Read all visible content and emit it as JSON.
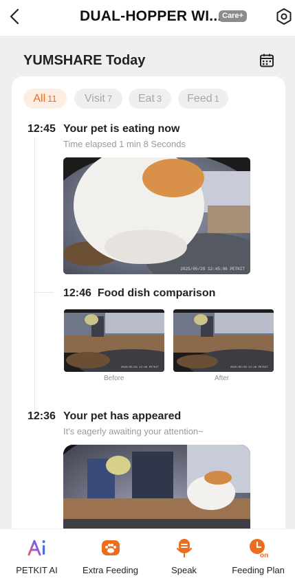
{
  "header": {
    "title": "DUAL-HOPPER WI...",
    "badge": "Care+"
  },
  "section": {
    "title": "YUMSHARE Today"
  },
  "filters": [
    {
      "label": "All",
      "count": "11",
      "active": true
    },
    {
      "label": "Visit",
      "count": "7",
      "active": false
    },
    {
      "label": "Eat",
      "count": "3",
      "active": false
    },
    {
      "label": "Feed",
      "count": "1",
      "active": false
    }
  ],
  "events": [
    {
      "time": "12:45",
      "title": "Your pet is eating now",
      "subtitle": "Time elapsed  1 min 8 Seconds",
      "stamp": "2025/05/29  12:45:06  PETKIT"
    },
    {
      "time": "12:46",
      "title": "Food dish comparison",
      "before_label": "Before",
      "after_label": "After",
      "stamp_small": "2025/05/29 12:46 PETKIT"
    },
    {
      "time": "12:36",
      "title": "Your pet has appeared",
      "subtitle": "It's eagerly awaiting your attention~"
    }
  ],
  "nav": [
    {
      "label": "PETKIT AI",
      "icon": "ai-icon"
    },
    {
      "label": "Extra Feeding",
      "icon": "paw-bowl-icon"
    },
    {
      "label": "Speak",
      "icon": "microphone-icon"
    },
    {
      "label": "Feeding Plan",
      "icon": "clock-on-icon"
    }
  ],
  "colors": {
    "accent": "#ec6d1e",
    "panel_bg": "#efefef",
    "chip_active_bg": "#fdeee3"
  }
}
